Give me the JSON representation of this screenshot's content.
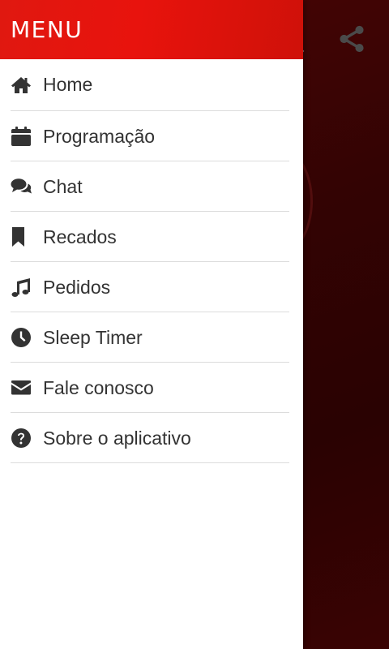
{
  "drawer": {
    "title": "MENU",
    "items": [
      {
        "label": "Home",
        "icon": "home-icon"
      },
      {
        "label": "Programação",
        "icon": "calendar-icon"
      },
      {
        "label": "Chat",
        "icon": "chat-icon"
      },
      {
        "label": "Recados",
        "icon": "bookmark-icon"
      },
      {
        "label": "Pedidos",
        "icon": "music-icon"
      },
      {
        "label": "Sleep Timer",
        "icon": "clock-icon"
      },
      {
        "label": "Fale conosco",
        "icon": "envelope-icon"
      },
      {
        "label": "Sobre o aplicativo",
        "icon": "question-circle-icon"
      }
    ]
  },
  "app": {
    "share_icon": "share-icon"
  },
  "colors": {
    "header_red": "#e8130d",
    "background_dark_red": "#330303",
    "text": "#333333"
  }
}
